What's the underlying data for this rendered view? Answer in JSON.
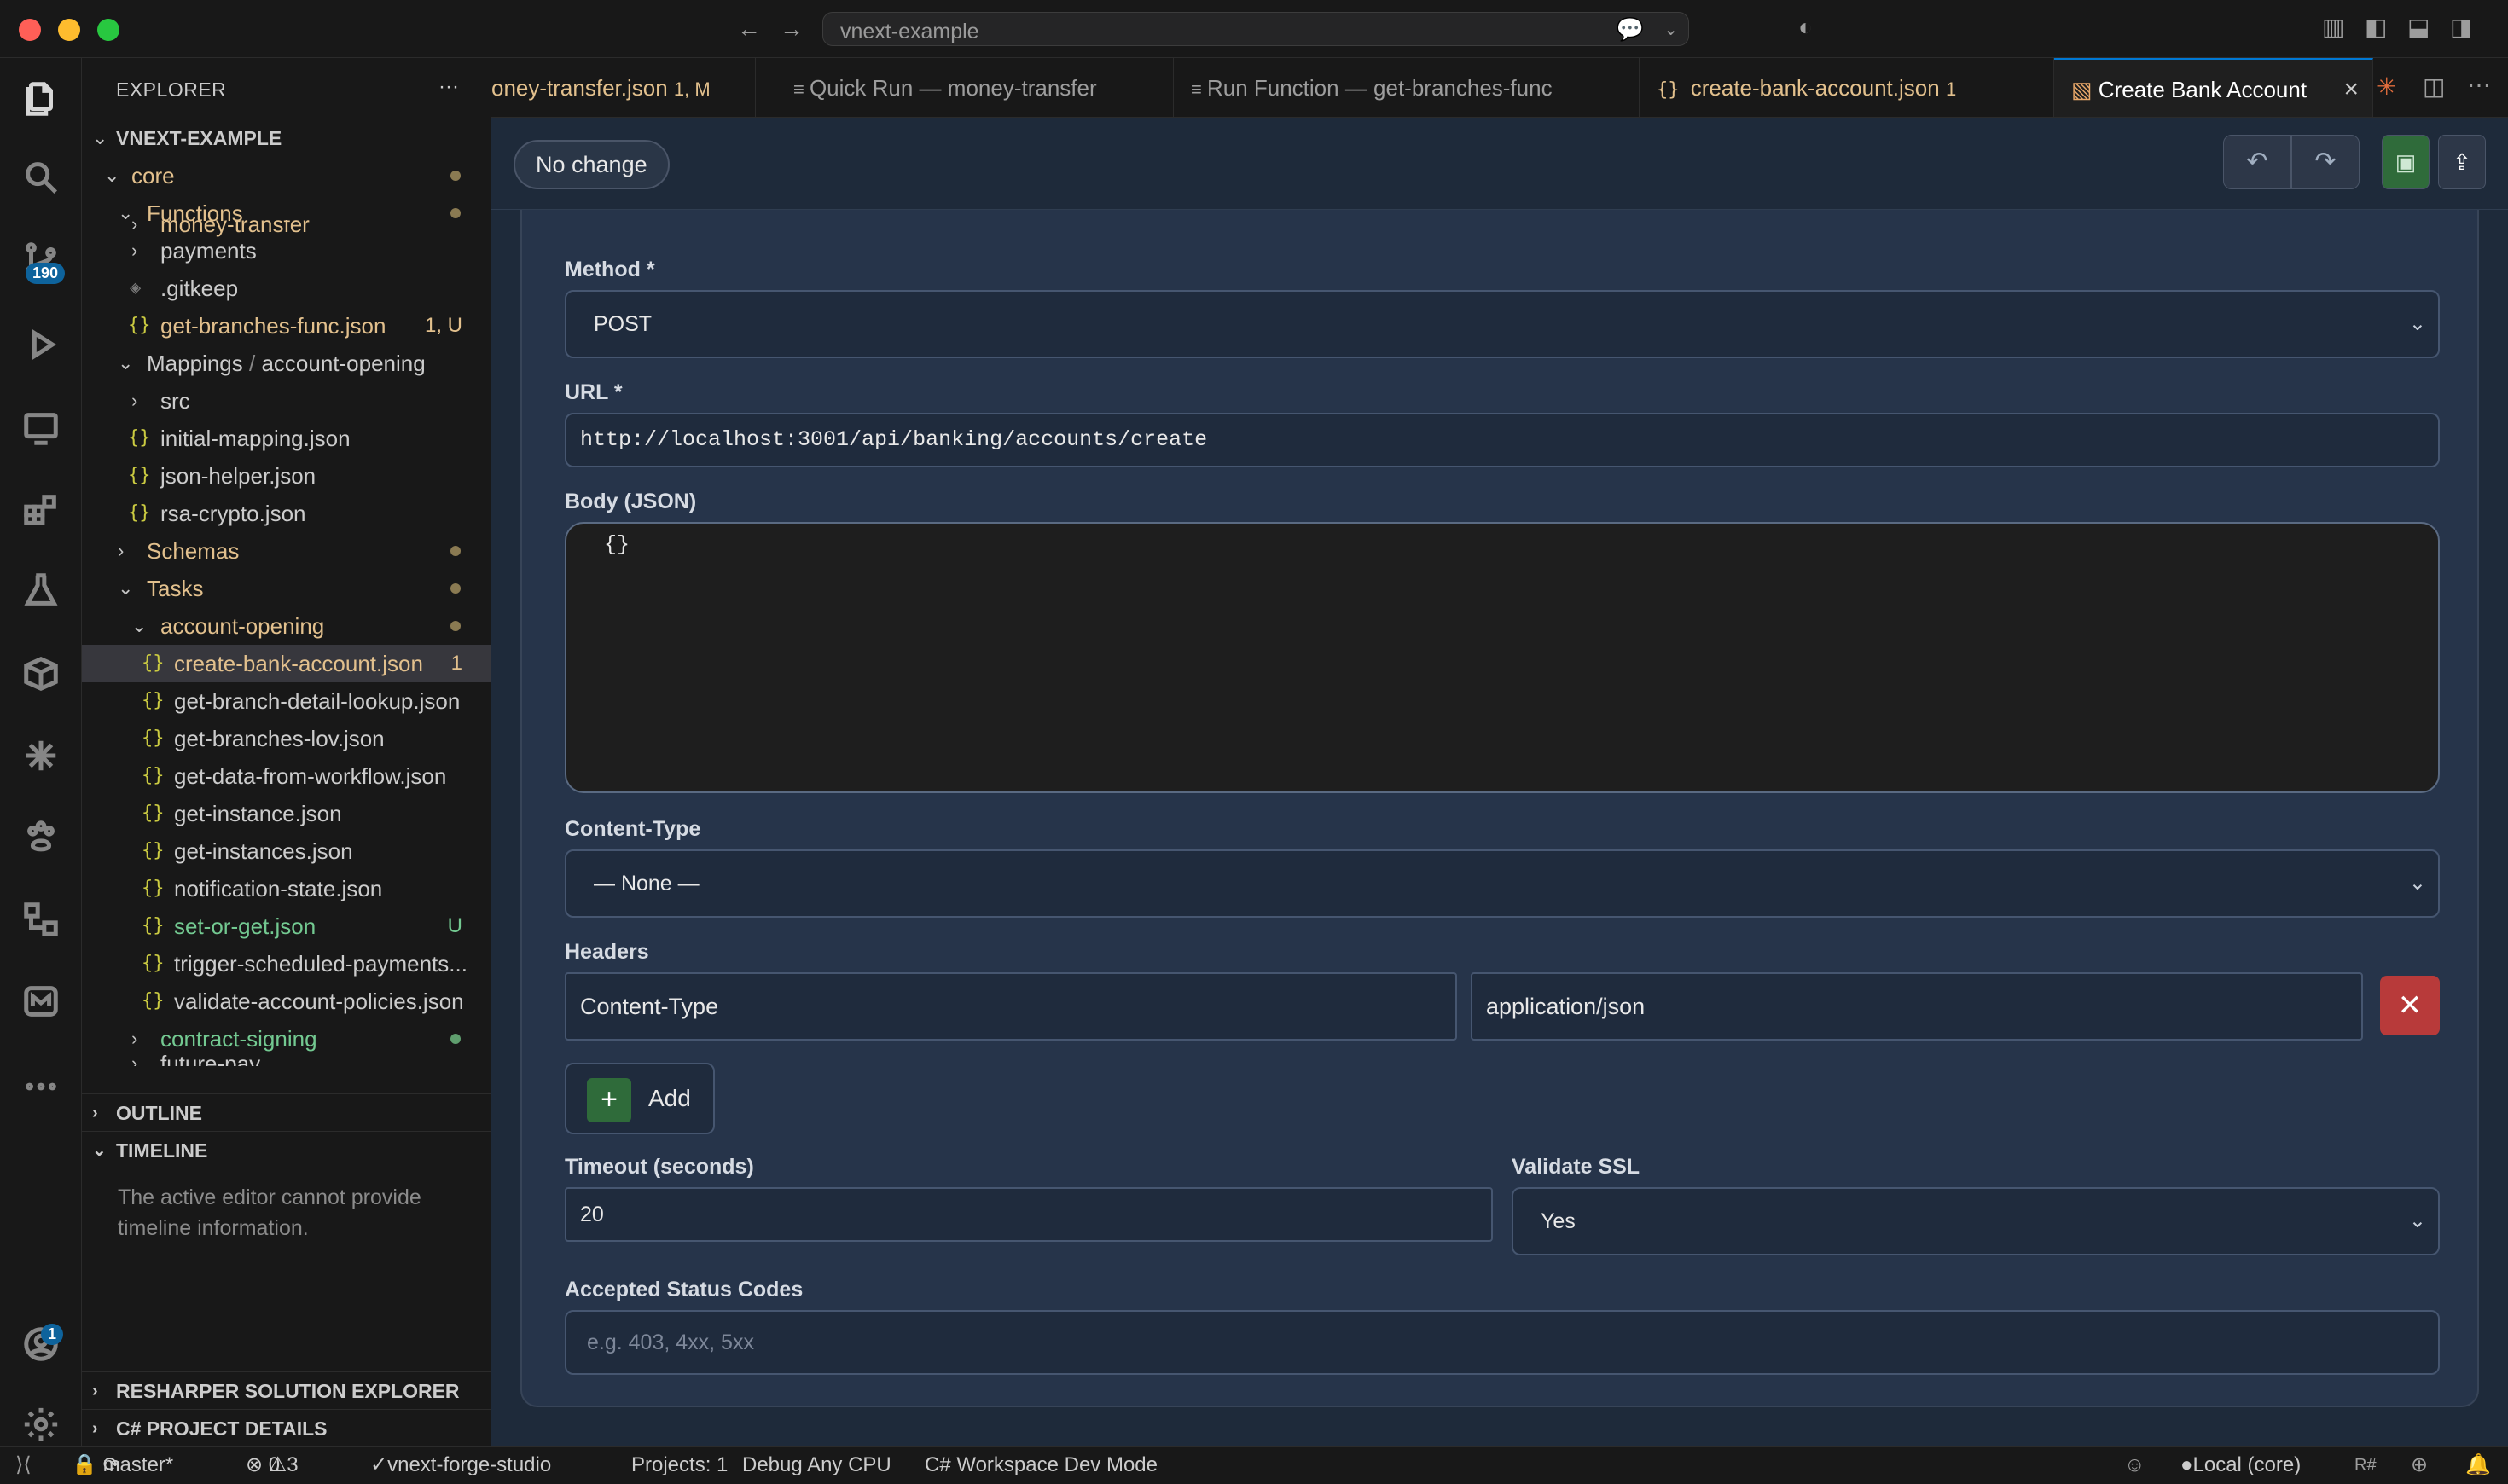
{
  "window": {
    "search_text": "vnext-example",
    "traffic_colors": [
      "#ff5f57",
      "#febc2e",
      "#28c840"
    ]
  },
  "activity": {
    "scm_badge": "190",
    "account_badge": "1"
  },
  "explorer": {
    "title": "EXPLORER",
    "more": "···",
    "root": "VNEXT-EXAMPLE",
    "items": [
      {
        "label": "core"
      },
      {
        "label": "Functions"
      },
      {
        "label": "money-transfer"
      },
      {
        "label": "payments"
      },
      {
        "label": ".gitkeep"
      },
      {
        "label": "get-branches-func.json",
        "status": "1, U"
      },
      {
        "label": "Mappings",
        "sep": "/",
        "label2": "account-opening"
      },
      {
        "label": "src"
      },
      {
        "label": "initial-mapping.json"
      },
      {
        "label": "json-helper.json"
      },
      {
        "label": "rsa-crypto.json"
      },
      {
        "label": "Schemas"
      },
      {
        "label": "Tasks"
      },
      {
        "label": "account-opening"
      },
      {
        "label": "create-bank-account.json",
        "status": "1"
      },
      {
        "label": "get-branch-detail-lookup.json"
      },
      {
        "label": "get-branches-lov.json"
      },
      {
        "label": "get-data-from-workflow.json"
      },
      {
        "label": "get-instance.json"
      },
      {
        "label": "get-instances.json"
      },
      {
        "label": "notification-state.json"
      },
      {
        "label": "set-or-get.json",
        "status": "U"
      },
      {
        "label": "trigger-scheduled-payments..."
      },
      {
        "label": "validate-account-policies.json"
      },
      {
        "label": "contract-signing"
      },
      {
        "label": "future-pay"
      }
    ],
    "outline": "OUTLINE",
    "timeline": "TIMELINE",
    "timeline_msg": "The active editor cannot provide timeline information.",
    "resharper": "RESHARPER SOLUTION EXPLORER",
    "csharp": "C# PROJECT DETAILS"
  },
  "tabs": [
    {
      "label": "oney-transfer.json",
      "status": "1, M"
    },
    {
      "label": "Quick Run — money-transfer"
    },
    {
      "label": "Run Function — get-branches-func"
    },
    {
      "label": "create-bank-account.json",
      "status": "1"
    },
    {
      "label": "Create Bank Account"
    }
  ],
  "editor": {
    "status_pill": "No change",
    "method_label": "Method",
    "method_value": "POST",
    "url_label": "URL",
    "url_value": "http://localhost:3001/api/banking/accounts/create",
    "body_label": "Body (JSON)",
    "body_value": "{}",
    "content_type_label": "Content-Type",
    "content_type_value": "— None —",
    "headers_label": "Headers",
    "header_key": "Content-Type",
    "header_value": "application/json",
    "add_label": "Add",
    "timeout_label": "Timeout (seconds)",
    "timeout_value": "20",
    "ssl_label": "Validate SSL",
    "ssl_value": "Yes",
    "status_codes_label": "Accepted Status Codes",
    "status_codes_placeholder": "e.g. 403, 4xx, 5xx",
    "required_mark": "*"
  },
  "statusbar": {
    "branch": "master*",
    "errors": "0",
    "warnings": "3",
    "project_check": "vnext-forge-studio",
    "projects": "Projects: 1",
    "debug": "Debug Any CPU",
    "workspace": "C# Workspace Dev Mode",
    "local": "Local (core)"
  }
}
